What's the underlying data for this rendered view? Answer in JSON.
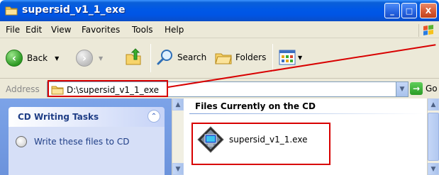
{
  "window": {
    "title": "supersid_v1_1_exe",
    "minimize_glyph": "_",
    "maximize_glyph": "□",
    "close_glyph": "X"
  },
  "menu": {
    "items": [
      "File",
      "Edit",
      "View",
      "Favorites",
      "Tools",
      "Help"
    ]
  },
  "toolbar": {
    "back_label": "Back",
    "search_label": "Search",
    "folders_label": "Folders",
    "view_icon": "views-icon"
  },
  "address": {
    "label": "Address",
    "value": "D:\\supersid_v1_1_exe",
    "go_label": "Go"
  },
  "task_pane": {
    "title": "CD Writing Tasks",
    "collapse_glyph": "⌃",
    "link_label": "Write these files to CD"
  },
  "content": {
    "group_header": "Files Currently on the CD",
    "files": [
      {
        "name": "supersid_v1_1.exe",
        "icon": "application-icon"
      }
    ]
  },
  "colors": {
    "titlebar": "#0058e6",
    "chrome": "#ece9d8",
    "taskpane": "#7ca3e8",
    "highlight": "#d80000"
  }
}
